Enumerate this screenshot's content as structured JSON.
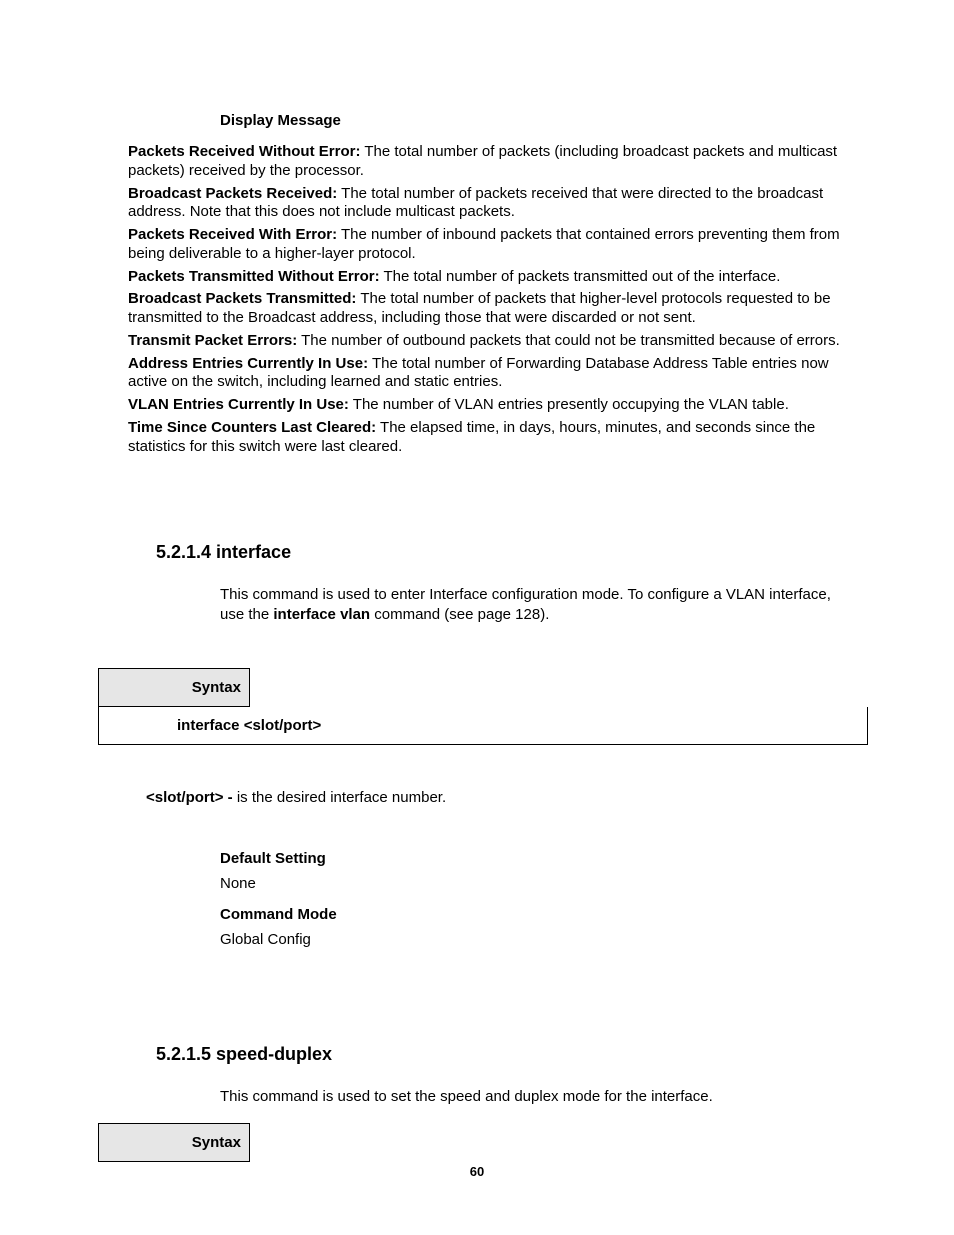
{
  "displayMessageHeading": "Display Message",
  "defs": [
    {
      "term": "Packets Received Without Error:",
      "desc": " The total number of packets (including broadcast packets and multicast packets) received by the processor."
    },
    {
      "term": "Broadcast Packets Received:",
      "desc": " The total number of packets received that were directed to the broadcast address. Note that this does not include multicast packets."
    },
    {
      "term": "Packets Received With Error:",
      "desc": " The number of inbound packets that contained errors preventing them from being deliverable to a higher-layer protocol."
    },
    {
      "term": "Packets Transmitted Without Error:",
      "desc": " The total number of packets transmitted out of the interface."
    },
    {
      "term": "Broadcast Packets Transmitted:",
      "desc": " The total number of packets that higher-level protocols requested to be transmitted to the Broadcast address, including those that were discarded or not sent."
    },
    {
      "term": "Transmit Packet Errors:",
      "desc": " The number of outbound packets that could not be transmitted because of errors."
    },
    {
      "term": "Address Entries Currently In Use:",
      "desc": " The total number of Forwarding Database Address Table entries now active on the switch, including learned and static entries."
    },
    {
      "term": "VLAN Entries Currently In Use:",
      "desc": " The number of VLAN entries presently occupying the VLAN table."
    },
    {
      "term": "Time Since Counters Last Cleared:",
      "desc": " The elapsed time, in days, hours, minutes, and seconds since the statistics for this switch were last cleared."
    }
  ],
  "sec1": {
    "number": "5.2.1.4 ",
    "title": "interface",
    "desc_pre": "This command is used to enter Interface configuration mode.   To configure a VLAN interface, use the ",
    "desc_bold": "interface vlan",
    "desc_post": " command (see page 128).",
    "syntaxLabel": "Syntax",
    "syntaxCmd": "interface <slot/port>",
    "paramTerm": "<slot/port> - ",
    "paramDesc": "is the desired interface number.",
    "defaultLabel": "Default Setting",
    "defaultValue": "None",
    "modeLabel": "Command Mode",
    "modeValue": "Global Config"
  },
  "sec2": {
    "number": "5.2.1.5 ",
    "title": "speed-duplex",
    "desc": "This command is used to set the speed and duplex mode for the interface.",
    "syntaxLabel": "Syntax"
  },
  "pageNumber": "60"
}
